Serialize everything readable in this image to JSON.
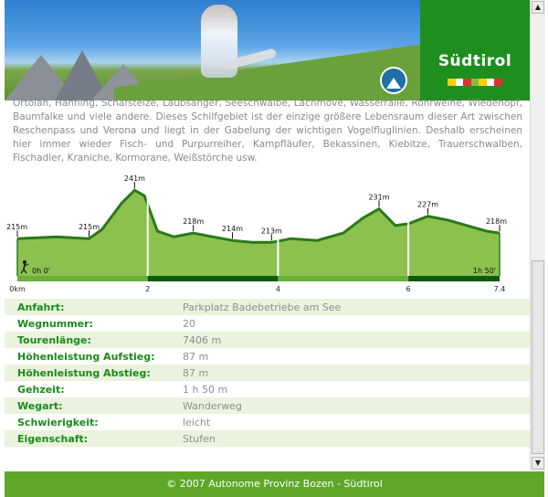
{
  "header": {
    "brand": "Südtirol"
  },
  "description": "Ortolan, Hänfling, Schafstelze, Laubsänger, Seeschwalbe, Lachmöve, Wasserralle, Rohrweihe, Wiedehopf, Baumfalke und viele andere. Dieses Schilfgebiet ist der einzige größere Lebensraum dieser Art zwischen Reschenpass und Verona und liegt in der Gabelung der wichtigen Vogelfluglinien. Deshalb erscheinen hier immer wieder Fisch- und Purpurreiher, Kampfläufer, Bekassinen, Kiebitze, Trauerschwalben, Fischadler, Kraniche, Kormorane, Weißstörche usw.",
  "chart_data": {
    "type": "area",
    "x_unit": "km",
    "y_unit": "m",
    "xlim": [
      0,
      7.4
    ],
    "x_ticks": [
      "0km",
      "2",
      "4",
      "6",
      "7.4"
    ],
    "x": [
      0,
      0.6,
      1.1,
      1.3,
      1.6,
      1.8,
      1.95,
      2.15,
      2.4,
      2.7,
      3.0,
      3.3,
      3.6,
      3.9,
      4.2,
      4.6,
      5.0,
      5.3,
      5.55,
      5.8,
      6.0,
      6.3,
      6.6,
      6.9,
      7.2,
      7.4
    ],
    "y": [
      215,
      216,
      215,
      220,
      234,
      241,
      238,
      219,
      216,
      218,
      216,
      214,
      213,
      213,
      215,
      214,
      218,
      226,
      231,
      222,
      223,
      227,
      225,
      222,
      219,
      218
    ],
    "labels": [
      {
        "text": "215m",
        "x": 0,
        "y": 215
      },
      {
        "text": "215m",
        "x": 1.1,
        "y": 215
      },
      {
        "text": "241m",
        "x": 1.8,
        "y": 241
      },
      {
        "text": "218m",
        "x": 2.7,
        "y": 218
      },
      {
        "text": "214m",
        "x": 3.3,
        "y": 214
      },
      {
        "text": "213m",
        "x": 3.9,
        "y": 213
      },
      {
        "text": "231m",
        "x": 5.55,
        "y": 231
      },
      {
        "text": "227m",
        "x": 6.3,
        "y": 227
      },
      {
        "text": "218m",
        "x": 7.4,
        "y": 218
      }
    ],
    "time_start": "0h 0'",
    "time_end": "1h 50'",
    "colors": {
      "fill": "#8cc04f",
      "line": "#2a7a18",
      "axis_bar": "#0e5a0e",
      "axis_alt": "#6ab03a"
    }
  },
  "details": [
    {
      "label": "Anfahrt:",
      "value": "Parkplatz Badebetriebe am See"
    },
    {
      "label": "Wegnummer:",
      "value": "20"
    },
    {
      "label": "Tourenlänge:",
      "value": "7406 m"
    },
    {
      "label": "Höhenleistung Aufstieg:",
      "value": "87 m"
    },
    {
      "label": "Höhenleistung Abstieg:",
      "value": "87 m"
    },
    {
      "label": "Gehzeit:",
      "value": "1 h 50 m"
    },
    {
      "label": "Wegart:",
      "value": "Wanderweg"
    },
    {
      "label": "Schwierigkeit:",
      "value": "leicht"
    },
    {
      "label": "Eigenschaft:",
      "value": "Stufen"
    }
  ],
  "footer": {
    "text": "© 2007 Autonome Provinz Bozen - Südtirol"
  },
  "scrollbar": {
    "up_glyph": "▲",
    "down_glyph": "▼"
  }
}
